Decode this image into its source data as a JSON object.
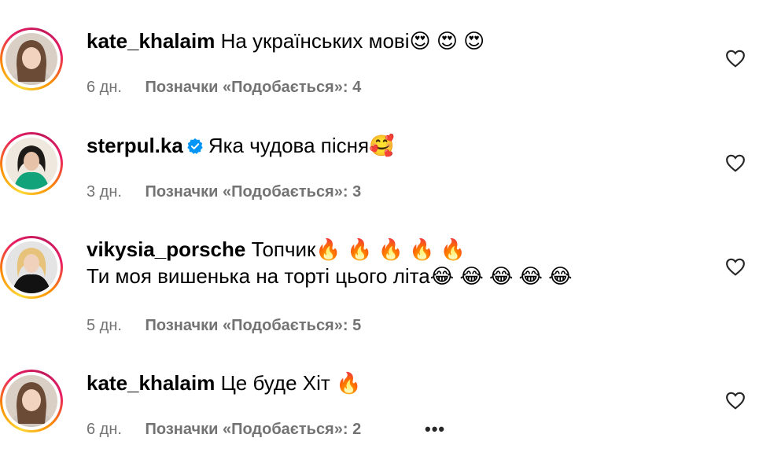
{
  "comments": [
    {
      "username": "kate_khalaim",
      "verified": false,
      "lines": [
        "На українських мові😍 😍 😍"
      ],
      "time": "6 дн.",
      "likes": "Позначки «Подобається»: 4"
    },
    {
      "username": "sterpul.ka",
      "verified": true,
      "lines": [
        "Яка чудова пісня🥰"
      ],
      "time": "3 дн.",
      "likes": "Позначки «Подобається»: 3"
    },
    {
      "username": "vikysia_porsche",
      "verified": false,
      "lines": [
        "Топчик🔥 🔥 🔥 🔥 🔥",
        "Ти моя вишенька на торті цього літа😂 😂 😂 😂 😂"
      ],
      "time": "5 дн.",
      "likes": "Позначки «Подобається»: 5"
    },
    {
      "username": "kate_khalaim",
      "verified": false,
      "lines": [
        "Це буде Хіт 🔥"
      ],
      "time": "6 дн.",
      "likes": "Позначки «Подобається»: 2",
      "more": "•••"
    }
  ],
  "icons": {
    "like": "heart-outline-icon",
    "verified": "verified-badge-icon",
    "more": "more-options-icon"
  },
  "colors": {
    "verified": "#0095f6",
    "meta_text": "#737373"
  }
}
